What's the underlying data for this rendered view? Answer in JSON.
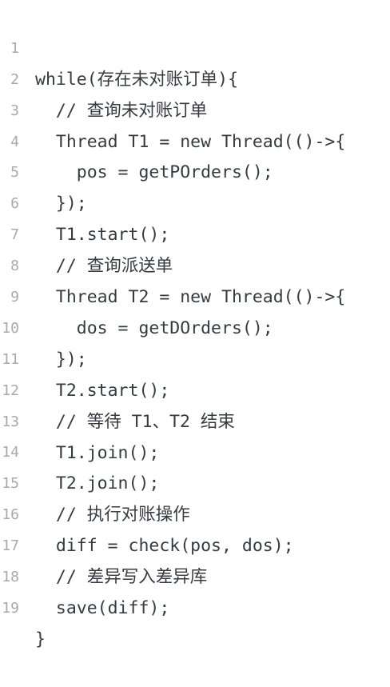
{
  "editor": {
    "lines": [
      {
        "number": "1",
        "text": "while(存在未对账订单){"
      },
      {
        "number": "2",
        "text": "  // 查询未对账订单"
      },
      {
        "number": "3",
        "text": "  Thread T1 = new Thread(()->{"
      },
      {
        "number": "4",
        "text": "    pos = getPOrders();"
      },
      {
        "number": "5",
        "text": "  });"
      },
      {
        "number": "6",
        "text": "  T1.start();"
      },
      {
        "number": "7",
        "text": "  // 查询派送单"
      },
      {
        "number": "8",
        "text": "  Thread T2 = new Thread(()->{"
      },
      {
        "number": "9",
        "text": "    dos = getDOrders();"
      },
      {
        "number": "10",
        "text": "  });"
      },
      {
        "number": "11",
        "text": "  T2.start();"
      },
      {
        "number": "12",
        "text": "  // 等待 T1、T2 结束"
      },
      {
        "number": "13",
        "text": "  T1.join();"
      },
      {
        "number": "14",
        "text": "  T2.join();"
      },
      {
        "number": "15",
        "text": "  // 执行对账操作"
      },
      {
        "number": "16",
        "text": "  diff = check(pos, dos);"
      },
      {
        "number": "17",
        "text": "  // 差异写入差异库"
      },
      {
        "number": "18",
        "text": "  save(diff);"
      },
      {
        "number": "19",
        "text": "}"
      }
    ]
  }
}
